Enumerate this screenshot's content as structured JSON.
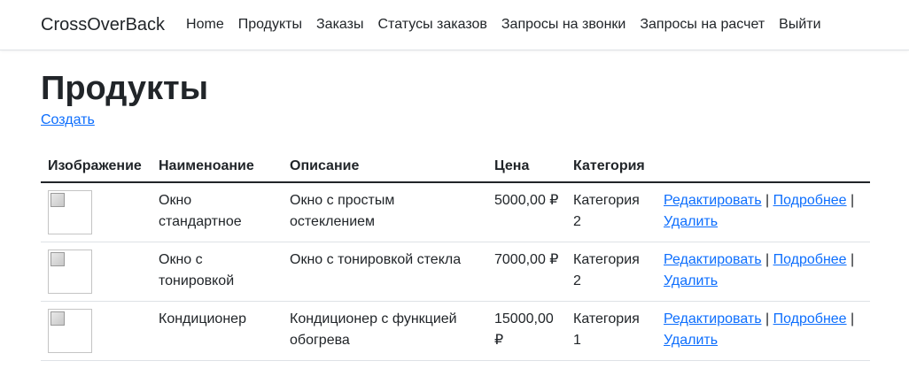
{
  "navbar": {
    "brand": "CrossOverBack",
    "items": [
      "Home",
      "Продукты",
      "Заказы",
      "Статусы заказов",
      "Запросы на звонки",
      "Запросы на расчет",
      "Выйти"
    ]
  },
  "page": {
    "title": "Продукты",
    "create_label": "Создать"
  },
  "table": {
    "headers": [
      "Изображение",
      "Наименоание",
      "Описание",
      "Цена",
      "Категория",
      ""
    ],
    "rows": [
      {
        "name": "Окно стандартное",
        "description": "Окно с простым остеклением",
        "price": "5000,00 ₽",
        "category": "Категория 2",
        "edit": "Редактировать",
        "details": "Подробнее",
        "delete": "Удалить"
      },
      {
        "name": "Окно с тонировкой",
        "description": "Окно с тонировкой стекла",
        "price": "7000,00 ₽",
        "category": "Категория 2",
        "edit": "Редактировать",
        "details": "Подробнее",
        "delete": "Удалить"
      },
      {
        "name": "Кондиционер",
        "description": "Кондиционер с функцией обогрева",
        "price": "15000,00 ₽",
        "category": "Категория 1",
        "edit": "Редактировать",
        "details": "Подробнее",
        "delete": "Удалить"
      }
    ],
    "separator": "|"
  }
}
